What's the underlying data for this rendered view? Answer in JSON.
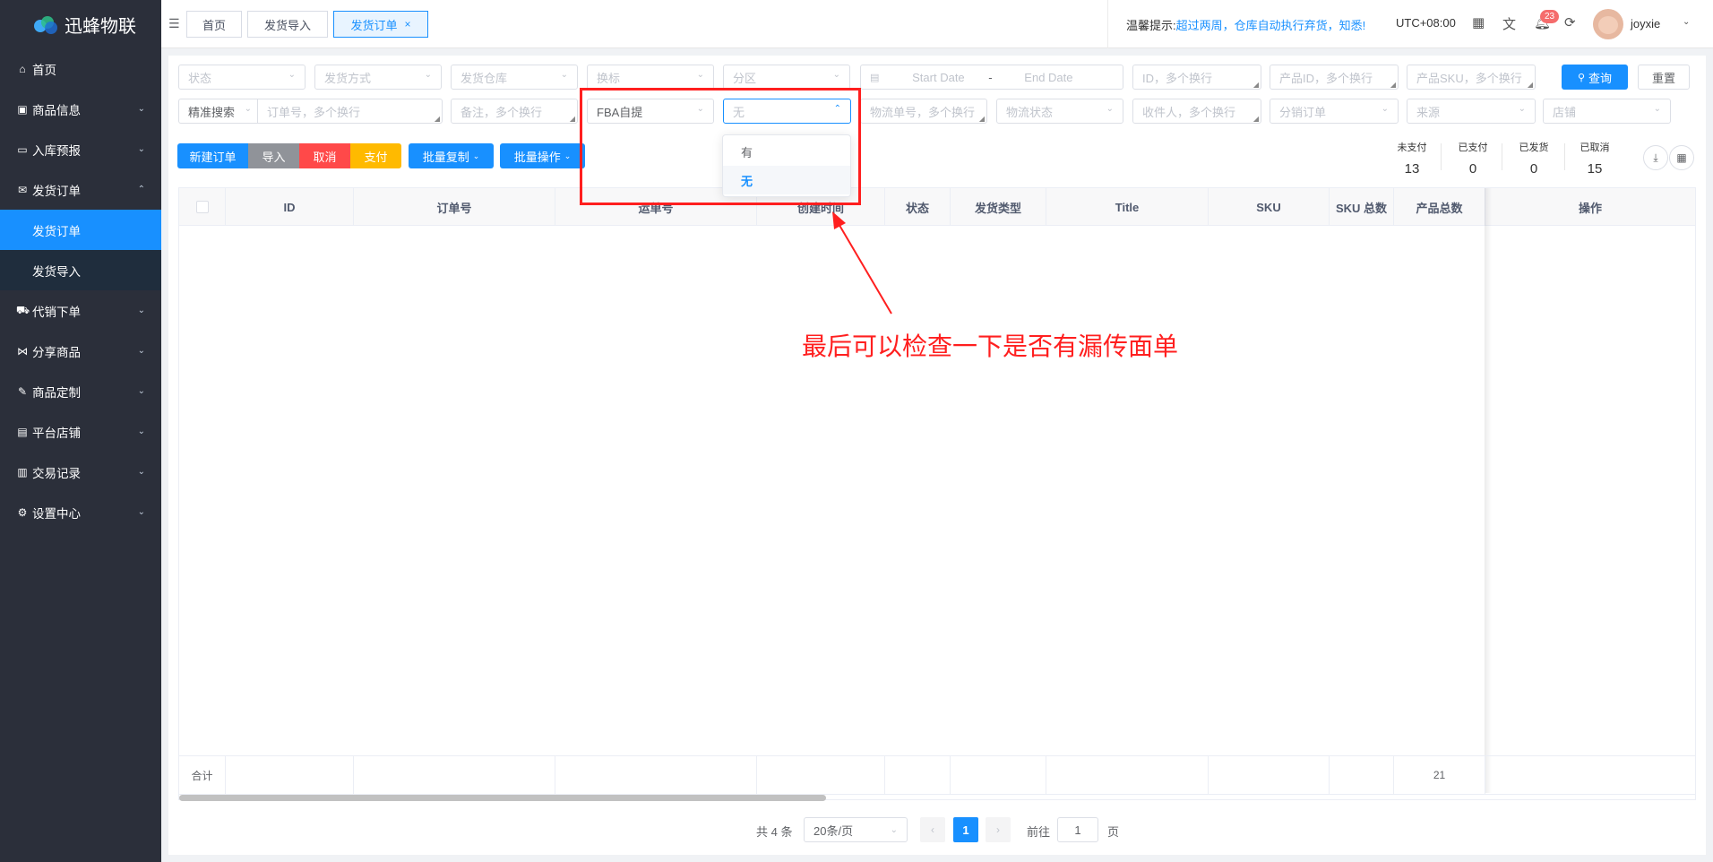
{
  "app": {
    "name": "迅蜂物联"
  },
  "sidebar": {
    "items": [
      {
        "label": "首页",
        "icon": "home-icon"
      },
      {
        "label": "商品信息",
        "icon": "gift-icon"
      },
      {
        "label": "入库预报",
        "icon": "inbox-icon"
      },
      {
        "label": "发货订单",
        "icon": "mail-icon",
        "expanded": true
      },
      {
        "label": "发货订单",
        "sub": true,
        "active": true
      },
      {
        "label": "发货导入",
        "sub": true
      },
      {
        "label": "代销下单",
        "icon": "cart-icon"
      },
      {
        "label": "分享商品",
        "icon": "share-icon"
      },
      {
        "label": "商品定制",
        "icon": "brush-icon"
      },
      {
        "label": "平台店铺",
        "icon": "shop-icon"
      },
      {
        "label": "交易记录",
        "icon": "record-icon"
      },
      {
        "label": "设置中心",
        "icon": "gear-icon"
      }
    ]
  },
  "tags": [
    {
      "label": "首页"
    },
    {
      "label": "发货导入"
    },
    {
      "label": "发货订单",
      "active": true,
      "close": "×"
    }
  ],
  "header": {
    "notice_prefix": "温馨提示:",
    "notice_link": "超过两周，仓库自动执行弃货，知悉!",
    "timezone": "UTC+08:00",
    "notification_count": "23",
    "username": "joyxie"
  },
  "filters": {
    "row1": {
      "status": "状态",
      "ship_method": "发货方式",
      "warehouse": "发货仓库",
      "label_change": "换标",
      "partition": "分区",
      "start_date": "Start Date",
      "date_sep": "-",
      "end_date": "End Date",
      "id": "ID，多个换行",
      "product_id": "产品ID，多个换行",
      "product_sku": "产品SKU，多个换行"
    },
    "row2": {
      "precise_search": "精准搜索",
      "order_no": "订单号，多个换行",
      "remark": "备注，多个换行",
      "fba": "FBA自提",
      "has_label": "无",
      "tracking_no": "物流单号，多个换行",
      "logistics_status": "物流状态",
      "recipient": "收件人，多个换行",
      "distribution_order": "分销订单",
      "source": "来源",
      "store": "店铺"
    },
    "search_label": "查询",
    "reset_label": "重置"
  },
  "dropdown": {
    "options": [
      "有",
      "无"
    ],
    "selected": "无"
  },
  "actions": {
    "new_order": "新建订单",
    "import": "导入",
    "cancel": "取消",
    "pay": "支付",
    "batch_copy": "批量复制",
    "batch_ops": "批量操作"
  },
  "stats": [
    {
      "label": "未支付",
      "value": "13"
    },
    {
      "label": "已支付",
      "value": "0"
    },
    {
      "label": "已发货",
      "value": "0"
    },
    {
      "label": "已取消",
      "value": "15"
    }
  ],
  "table": {
    "columns": [
      "ID",
      "订单号",
      "运单号",
      "创建时间",
      "状态",
      "发货类型",
      "Title",
      "SKU",
      "SKU 总数",
      "产品总数",
      "操作"
    ],
    "footer_label": "合计",
    "footer_product_total": "21"
  },
  "pagination": {
    "total": "共 4 条",
    "page_size": "20条/页",
    "current": "1",
    "goto_label": "前往",
    "goto_value": "1",
    "page_suffix": "页"
  },
  "annotation": {
    "text": "最后可以检查一下是否有漏传面单",
    "color": "#ff1f1f"
  }
}
